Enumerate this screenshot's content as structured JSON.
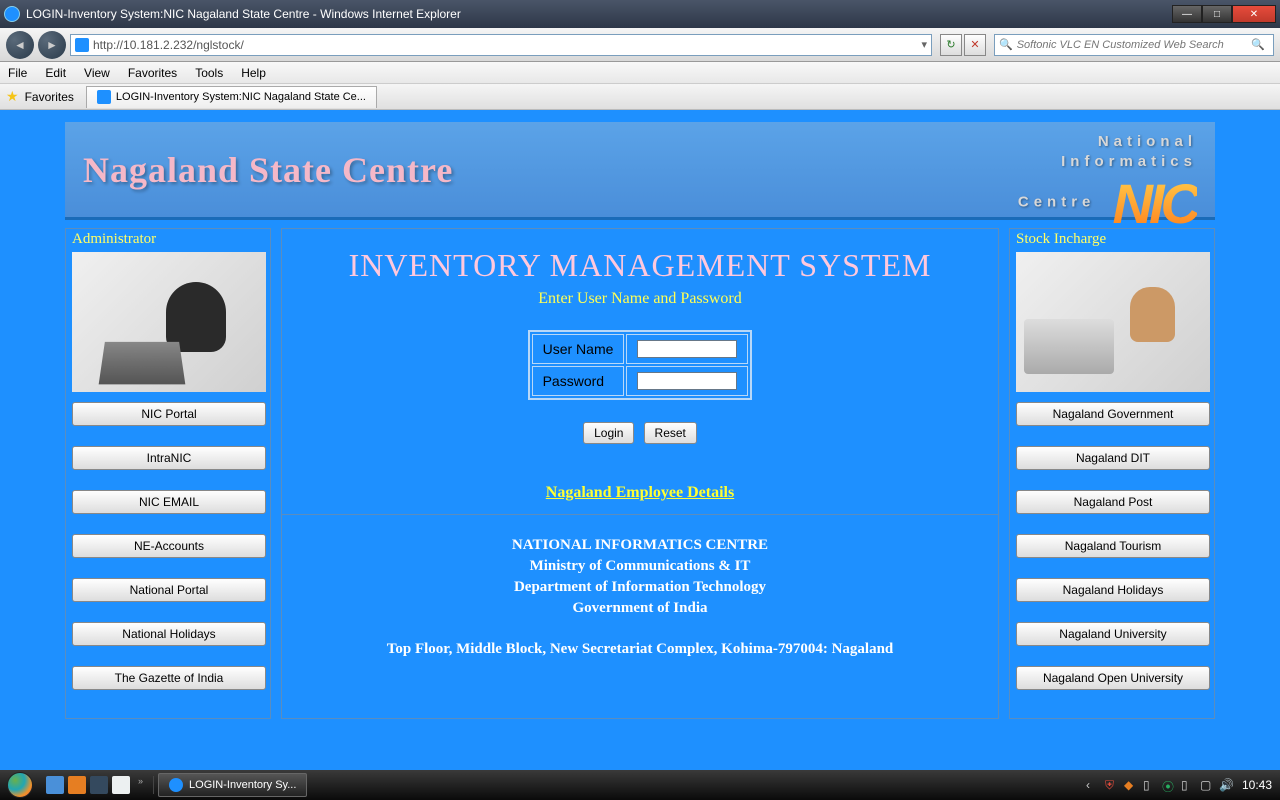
{
  "window": {
    "title": "LOGIN-Inventory System:NIC Nagaland State Centre - Windows Internet Explorer"
  },
  "nav": {
    "url": "http://10.181.2.232/nglstock/",
    "search_placeholder": "Softonic VLC EN Customized Web Search"
  },
  "menu": {
    "file": "File",
    "edit": "Edit",
    "view": "View",
    "favorites": "Favorites",
    "tools": "Tools",
    "help": "Help"
  },
  "favbar": {
    "favorites": "Favorites",
    "tab_title": "LOGIN-Inventory System:NIC Nagaland State Ce..."
  },
  "banner": {
    "left": "Nagaland State Centre",
    "r1": "National",
    "r2": "Informatics",
    "r3": "Centre",
    "nic": "NIC"
  },
  "left_sidebar": {
    "title": "Administrator",
    "btns": [
      "NIC Portal",
      "IntraNIC",
      "NIC EMAIL",
      "NE-Accounts",
      "National Portal",
      "National Holidays",
      "The Gazette of India"
    ]
  },
  "right_sidebar": {
    "title": "Stock Incharge",
    "btns": [
      "Nagaland Government",
      "Nagaland DIT",
      "Nagaland Post",
      "Nagaland Tourism",
      "Nagaland Holidays",
      "Nagaland University",
      "Nagaland Open University"
    ]
  },
  "main": {
    "title": "INVENTORY MANAGEMENT SYSTEM",
    "subtitle": "Enter User Name and Password",
    "username_label": "User Name",
    "password_label": "Password",
    "login_btn": "Login",
    "reset_btn": "Reset",
    "emp_link": "Nagaland Employee Details",
    "footer1": "NATIONAL INFORMATICS CENTRE",
    "footer2": "Ministry of Communications & IT",
    "footer3": "Department of Information Technology",
    "footer4": "Government of India",
    "address": "Top Floor, Middle Block, New Secretariat Complex, Kohima-797004: Nagaland"
  },
  "taskbar": {
    "task": "LOGIN-Inventory Sy...",
    "clock": "10:43"
  }
}
